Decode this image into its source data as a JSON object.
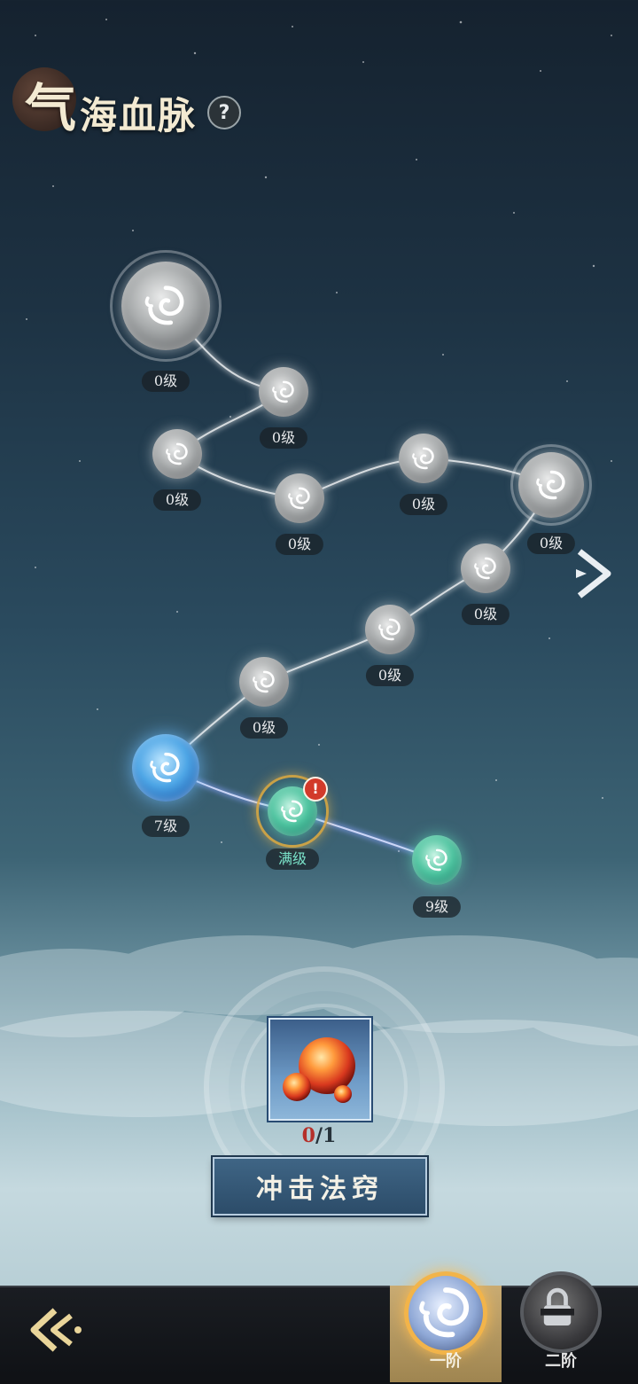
{
  "header": {
    "title_first": "气",
    "title_rest": "海血脉",
    "help_label": "?"
  },
  "nodes": [
    {
      "id": "n1",
      "level": "0级",
      "state": "grey"
    },
    {
      "id": "n2",
      "level": "0级",
      "state": "grey"
    },
    {
      "id": "n3",
      "level": "0级",
      "state": "grey"
    },
    {
      "id": "n4",
      "level": "0级",
      "state": "grey"
    },
    {
      "id": "n5",
      "level": "0级",
      "state": "grey"
    },
    {
      "id": "n6",
      "level": "0级",
      "state": "grey"
    },
    {
      "id": "n7",
      "level": "0级",
      "state": "grey"
    },
    {
      "id": "n8",
      "level": "0级",
      "state": "grey"
    },
    {
      "id": "n9",
      "level": "0级",
      "state": "grey"
    },
    {
      "id": "n10",
      "level": "7级",
      "state": "blue"
    },
    {
      "id": "n11",
      "level": "满级",
      "state": "green",
      "alert": "!"
    },
    {
      "id": "n12",
      "level": "9级",
      "state": "green"
    }
  ],
  "item": {
    "name": "fire-orb-item",
    "count_current": "0",
    "count_separator": "/",
    "count_total": "1"
  },
  "action": {
    "label": "冲击法窍"
  },
  "tabs": [
    {
      "label": "一阶",
      "selected": true
    },
    {
      "label": "二阶",
      "selected": false
    }
  ],
  "colors": {
    "accent_gold": "#f2b44a",
    "alert_red": "#d23a2a",
    "max_level_teal": "#7be3c9",
    "button_blue": "#3f6585"
  }
}
